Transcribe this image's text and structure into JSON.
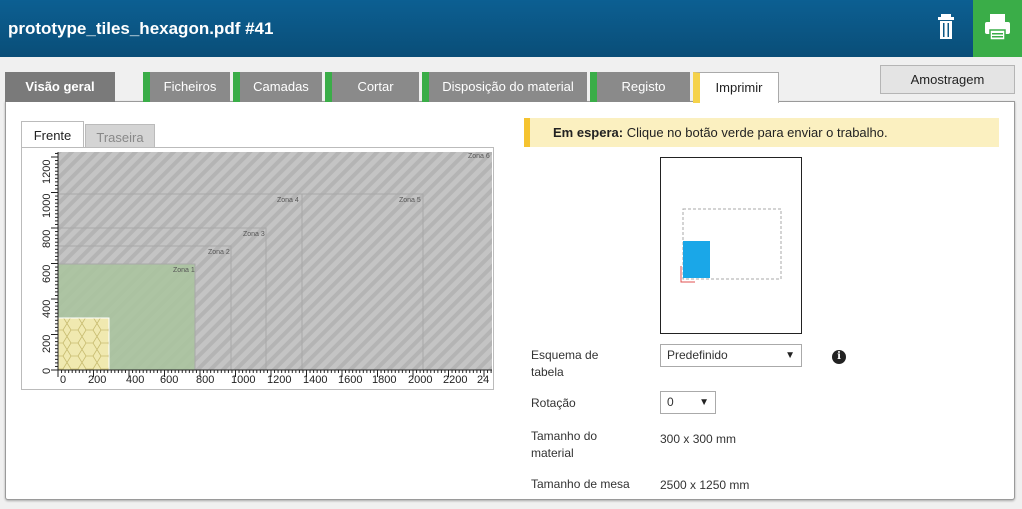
{
  "window": {
    "title": "prototype_tiles_hexagon.pdf #41"
  },
  "tabs": [
    {
      "label": "Visão geral"
    },
    {
      "label": "Ficheiros"
    },
    {
      "label": "Camadas"
    },
    {
      "label": "Cortar"
    },
    {
      "label": "Disposição do material"
    },
    {
      "label": "Registo"
    },
    {
      "label": "Imprimir"
    }
  ],
  "active_tab": "Imprimir",
  "sample_button": "Amostragem",
  "subtabs": {
    "front": "Frente",
    "back": "Traseira"
  },
  "status": {
    "strong": "Em espera:",
    "text": "Clique no botão verde para enviar o trabalho."
  },
  "table_zones": [
    "Zona 1",
    "Zona 2",
    "Zona 3",
    "Zona 4",
    "Zona 5",
    "Zona 6"
  ],
  "x_ticks": [
    "0",
    "200",
    "400",
    "600",
    "800",
    "1000",
    "1200",
    "1400",
    "1600",
    "1800",
    "2000",
    "2200",
    "24"
  ],
  "y_ticks": [
    "0",
    "200",
    "400",
    "600",
    "800",
    "1000",
    "1200"
  ],
  "settings": {
    "table_scheme_label": "Esquema de tabela",
    "table_scheme_value": "Predefinido",
    "rotation_label": "Rotação",
    "rotation_value": "0",
    "media_size_label": "Tamanho do material",
    "media_size_value": "300 x 300 mm",
    "table_size_label": "Tamanho de mesa",
    "table_size_value": "2500 x 1250 mm"
  },
  "colors": {
    "header": "#0a5a8a",
    "print_button": "#3aad48",
    "tab_accent": "#3aad48",
    "active_accent": "#f5d24a",
    "media_blue": "#1aa7e8"
  }
}
